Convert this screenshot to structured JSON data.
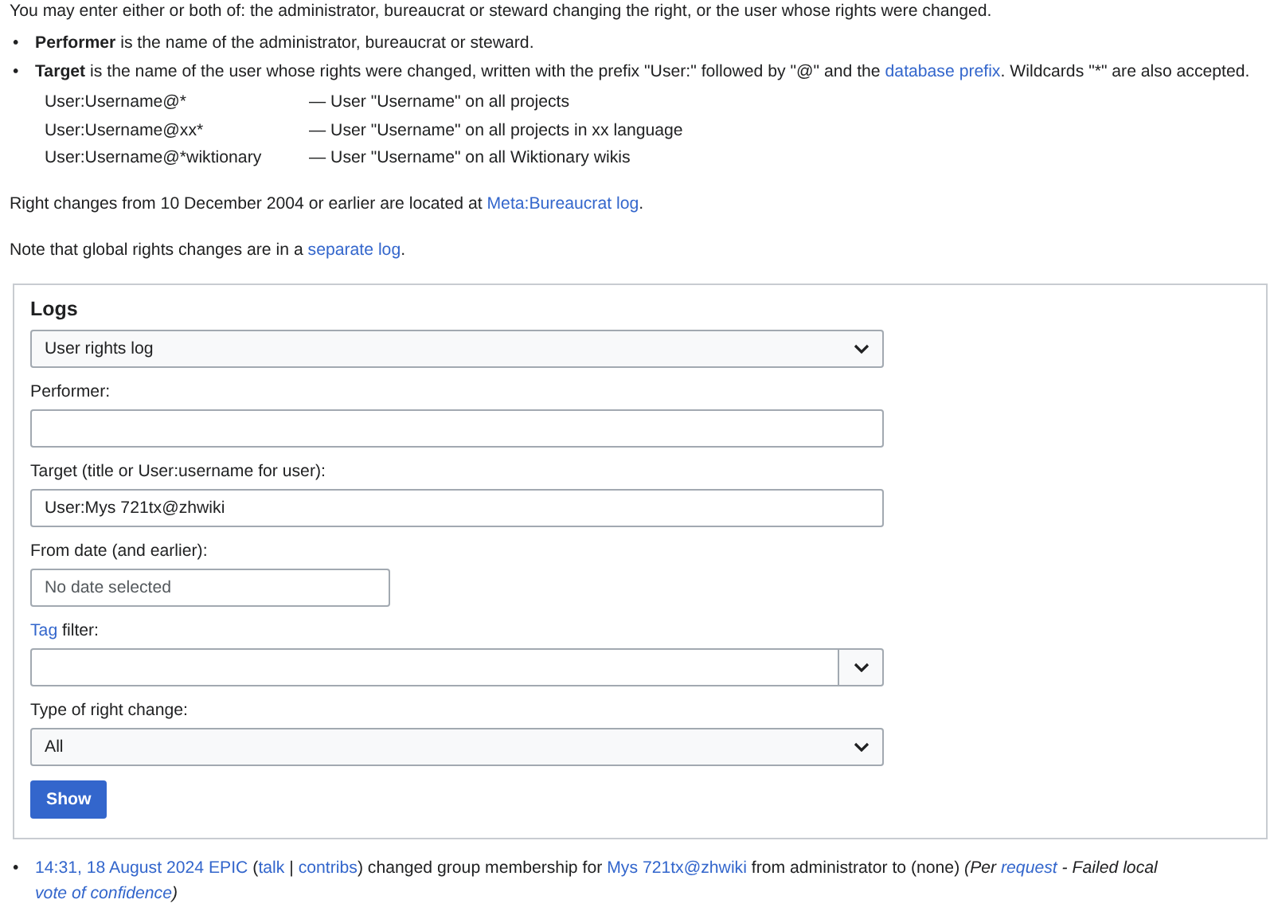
{
  "intro": "You may enter either or both of: the administrator, bureaucrat or steward changing the right, or the user whose rights were changed.",
  "bullets": [
    {
      "marker": "•",
      "parts": [
        {
          "kind": "bold",
          "text": "Performer"
        },
        {
          "kind": "plain",
          "text": " is the name of the administrator, bureaucrat or steward."
        }
      ]
    },
    {
      "marker": "•",
      "parts": [
        {
          "kind": "bold",
          "text": "Target"
        },
        {
          "kind": "plain",
          "text": " is the name of the user whose rights were changed, written with the prefix \"User:\" followed by \"@\" and the "
        },
        {
          "kind": "link",
          "text": "database prefix"
        },
        {
          "kind": "plain",
          "text": ". Wildcards \"*\" are also accepted."
        }
      ]
    }
  ],
  "examples": [
    {
      "pattern": "User:Username@*",
      "meaning": "— User \"Username\" on all projects"
    },
    {
      "pattern": "User:Username@xx*",
      "meaning": "— User \"Username\" on all projects in xx language"
    },
    {
      "pattern": "User:Username@*wiktionary",
      "meaning": "— User \"Username\" on all Wiktionary wikis"
    }
  ],
  "notes": [
    [
      {
        "kind": "plain",
        "text": "Right changes from 10 December 2004 or earlier are located at "
      },
      {
        "kind": "link",
        "text": "Meta:Bureaucrat log"
      },
      {
        "kind": "plain",
        "text": "."
      }
    ],
    [
      {
        "kind": "plain",
        "text": "Note that global rights changes are in a "
      },
      {
        "kind": "link",
        "text": "separate log"
      },
      {
        "kind": "plain",
        "text": "."
      }
    ]
  ],
  "form": {
    "legend": "Logs",
    "fields": [
      {
        "kind": "select",
        "value": "User rights log"
      },
      {
        "kind": "text",
        "label": [
          {
            "kind": "plain",
            "text": "Performer:"
          }
        ]
      },
      {
        "kind": "text",
        "label": [
          {
            "kind": "plain",
            "text": "Target (title or User:username for user):"
          }
        ],
        "value": "User:Mys 721tx@zhwiki"
      },
      {
        "kind": "date",
        "label": [
          {
            "kind": "plain",
            "text": "From date (and earlier):"
          }
        ],
        "placeholder": "No date selected"
      },
      {
        "kind": "combo",
        "label": [
          {
            "kind": "link",
            "text": "Tag"
          },
          {
            "kind": "plain",
            "text": " filter:"
          }
        ]
      },
      {
        "kind": "select",
        "label": [
          {
            "kind": "plain",
            "text": "Type of right change:"
          }
        ],
        "value": "All"
      }
    ],
    "button": "Show"
  },
  "entries": [
    {
      "marker": "•",
      "parts": [
        {
          "kind": "link",
          "text": "14:31, 18 August 2024"
        },
        {
          "kind": "link",
          "text": "EPIC",
          "spaced": true
        },
        {
          "kind": "plain",
          "text": " ("
        },
        {
          "kind": "link",
          "text": "talk"
        },
        {
          "kind": "plain",
          "text": " | "
        },
        {
          "kind": "link",
          "text": "contribs"
        },
        {
          "kind": "plain",
          "text": ") changed group membership for "
        },
        {
          "kind": "link",
          "text": "Mys 721tx@zhwiki"
        },
        {
          "kind": "plain",
          "text": " from administrator to (none) "
        },
        {
          "kind": "italic",
          "text": "(Per "
        },
        {
          "kind": "italic_link",
          "text": "request"
        },
        {
          "kind": "italic",
          "text": " - Failed local "
        },
        {
          "kind": "italic_link",
          "text": "vote of confidence"
        },
        {
          "kind": "italic",
          "text": ")"
        }
      ]
    }
  ]
}
